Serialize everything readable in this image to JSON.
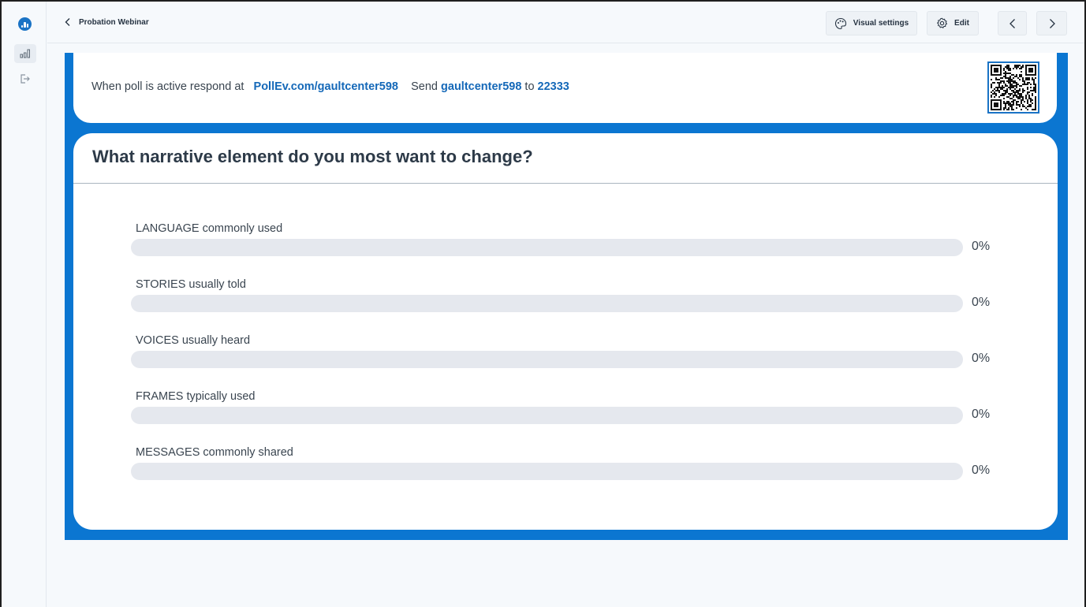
{
  "app": {
    "sidebar": {
      "items": [
        {
          "icon": "bar-chart-icon",
          "active": true
        },
        {
          "icon": "exit-icon",
          "active": false
        }
      ]
    },
    "header": {
      "back_label": "Probation Webinar",
      "visual_settings_label": "Visual settings",
      "edit_label": "Edit"
    },
    "instructions": {
      "prefix": "When poll is active respond at",
      "url": "PollEv.com/gaultcenter598",
      "send_word": "Send",
      "keyword": "gaultcenter598",
      "to_word": "to",
      "number": "22333"
    },
    "poll": {
      "question": "What narrative element do you most want to change?",
      "options": [
        {
          "label": "LANGUAGE commonly used",
          "percent": "0%",
          "fraction": 0
        },
        {
          "label": "STORIES usually told",
          "percent": "0%",
          "fraction": 0
        },
        {
          "label": "VOICES usually heard",
          "percent": "0%",
          "fraction": 0
        },
        {
          "label": "FRAMES typically used",
          "percent": "0%",
          "fraction": 0
        },
        {
          "label": "MESSAGES commonly shared",
          "percent": "0%",
          "fraction": 0
        }
      ]
    },
    "colors": {
      "brand_blue": "#0b76d1",
      "link_blue": "#1468b8",
      "track_gray": "#e5e8ee"
    }
  }
}
